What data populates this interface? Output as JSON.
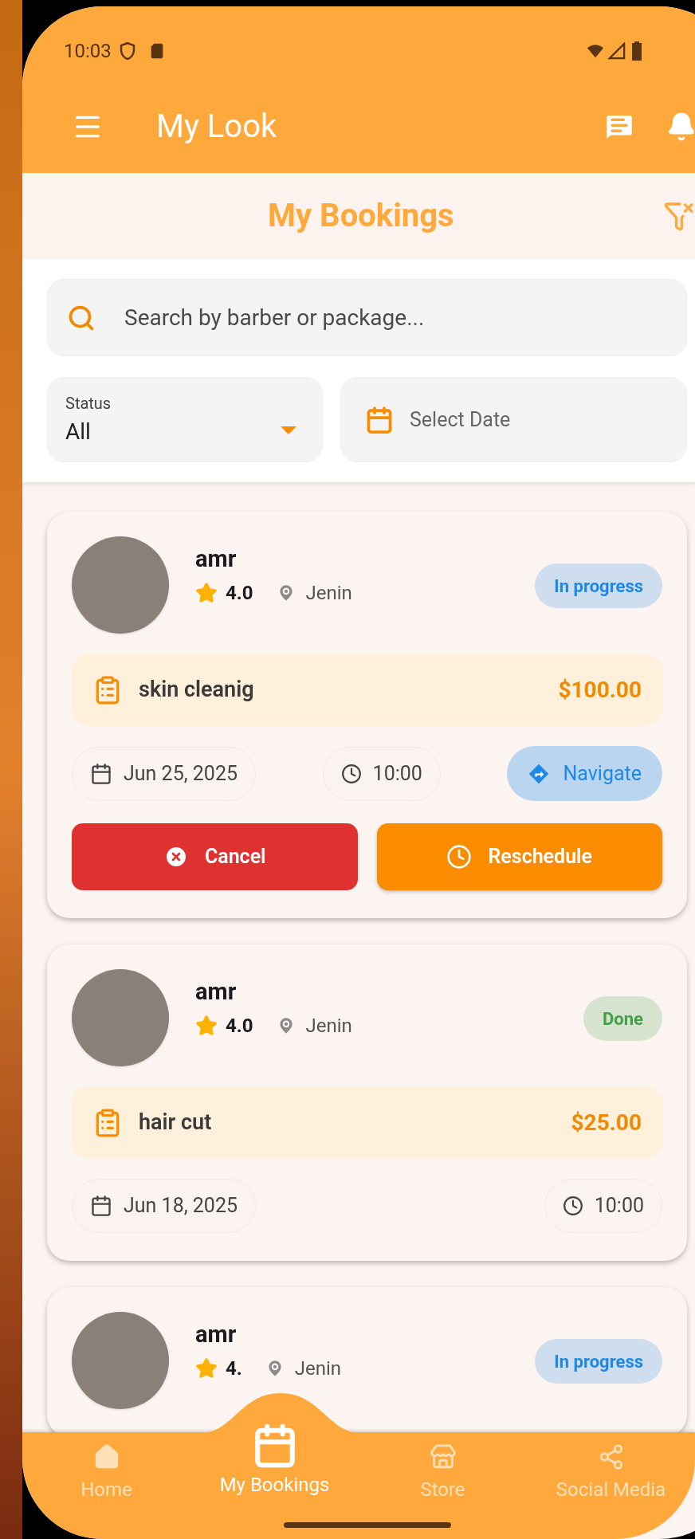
{
  "status_bar": {
    "time": "10:03"
  },
  "app_bar": {
    "title": "My Look"
  },
  "header": {
    "title": "My Bookings"
  },
  "search": {
    "placeholder": "Search by barber or package..."
  },
  "status_filter": {
    "label": "Status",
    "value": "All"
  },
  "date_filter": {
    "placeholder": "Select Date"
  },
  "cards": [
    {
      "name": "amr",
      "rating": "4.0",
      "location": "Jenin",
      "status": {
        "label": "In progress",
        "color": "#1e88e5"
      },
      "package": "skin cleanig",
      "price": "$100.00",
      "date": "Jun 25, 2025",
      "time": "10:00",
      "navigate": "Navigate",
      "actions": [
        {
          "kind": "cancel",
          "label": "Cancel"
        },
        {
          "kind": "reschedule",
          "label": "Reschedule"
        }
      ]
    },
    {
      "name": "amr",
      "rating": "4.0",
      "location": "Jenin",
      "status": {
        "label": "Done",
        "color": "#43a047"
      },
      "package": "hair cut",
      "price": "$25.00",
      "date": "Jun 18, 2025",
      "time": "10:00"
    },
    {
      "name": "amr",
      "rating": "4.",
      "location": "Jenin",
      "status": {
        "label": "In progress",
        "color": "#1e88e5"
      }
    }
  ],
  "nav": {
    "items": [
      {
        "kind": "home",
        "label": "Home",
        "selected": false
      },
      {
        "kind": "bookings",
        "label": "My Bookings",
        "selected": true
      },
      {
        "kind": "store",
        "label": "Store",
        "selected": false
      },
      {
        "kind": "share",
        "label": "Social Media",
        "selected": false
      }
    ]
  }
}
